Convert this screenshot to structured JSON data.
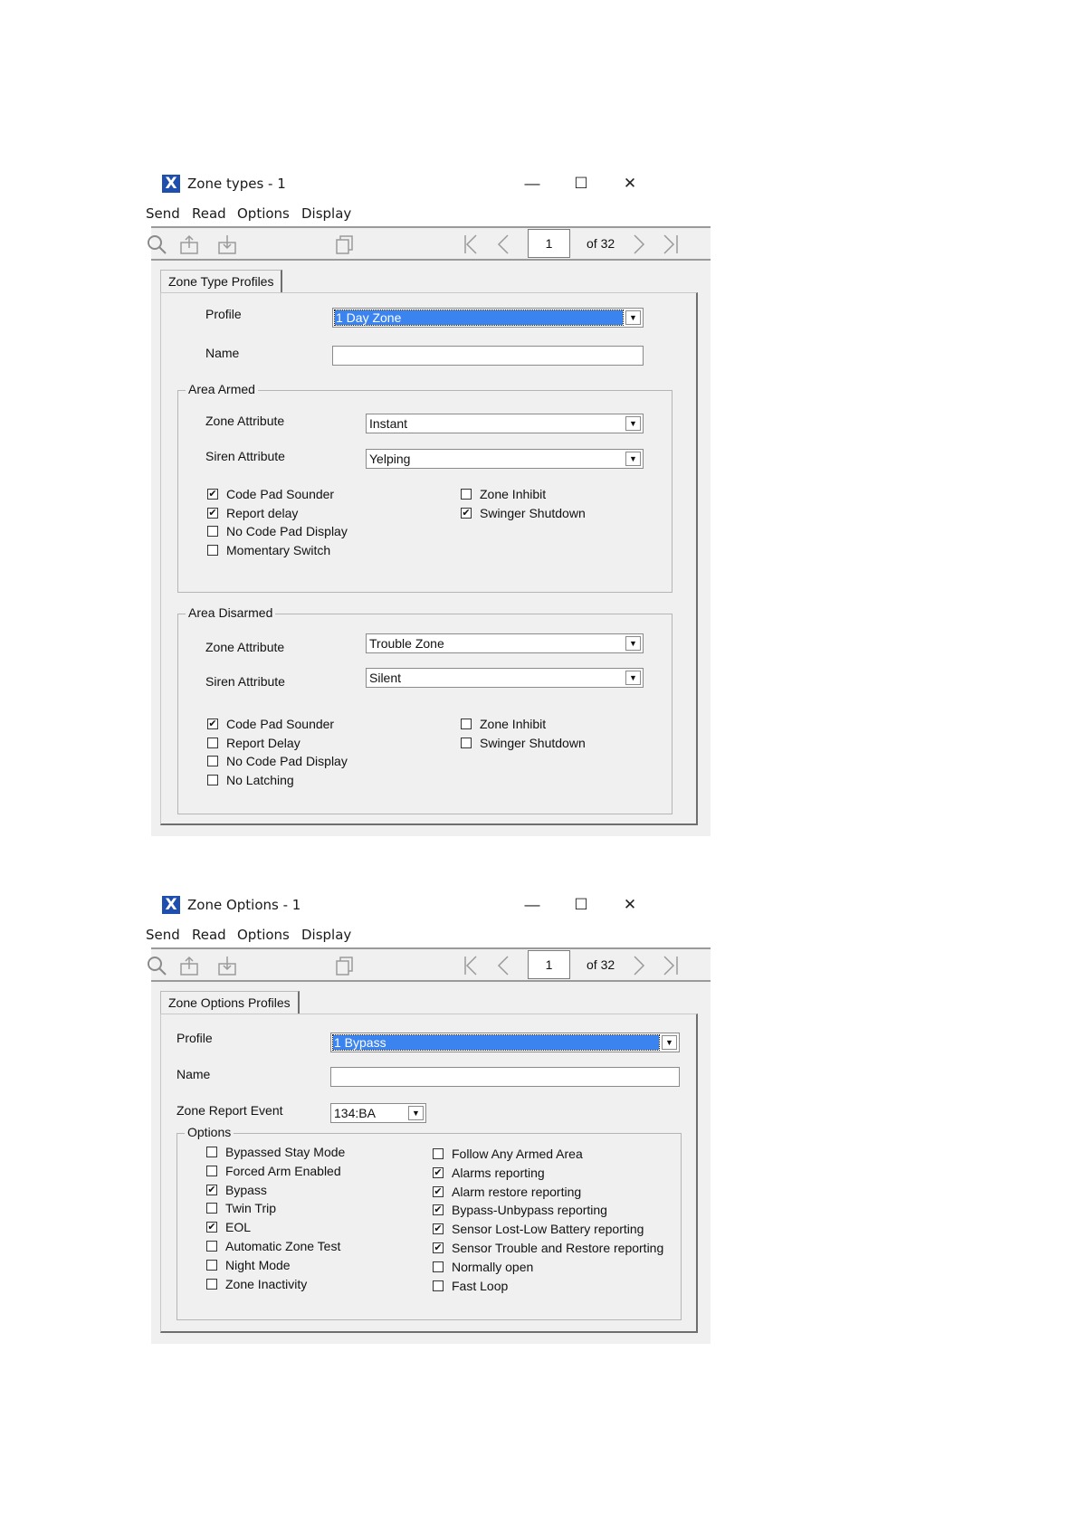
{
  "window1": {
    "title": "Zone types - 1",
    "menu": [
      "Send",
      "Read",
      "Options",
      "Display"
    ],
    "pager": {
      "page": "1",
      "of_label": "of 32"
    },
    "tab_label": "Zone Type Profiles",
    "profile_label": "Profile",
    "profile_value": "1 Day Zone",
    "name_label": "Name",
    "name_value": "",
    "area_armed": {
      "legend": "Area Armed",
      "zone_attribute_label": "Zone Attribute",
      "zone_attribute_value": "Instant",
      "siren_attribute_label": "Siren Attribute",
      "siren_attribute_value": "Yelping",
      "checks_left": [
        {
          "label": "Code Pad Sounder",
          "checked": true
        },
        {
          "label": "Report delay",
          "checked": true
        },
        {
          "label": "No Code Pad Display",
          "checked": false
        },
        {
          "label": "Momentary Switch",
          "checked": false
        }
      ],
      "checks_right": [
        {
          "label": "Zone Inhibit",
          "checked": false
        },
        {
          "label": "Swinger Shutdown",
          "checked": true
        }
      ]
    },
    "area_disarmed": {
      "legend": "Area Disarmed",
      "zone_attribute_label": "Zone Attribute",
      "zone_attribute_value": "Trouble Zone",
      "siren_attribute_label": "Siren Attribute",
      "siren_attribute_value": "Silent",
      "checks_left": [
        {
          "label": "Code Pad Sounder",
          "checked": true
        },
        {
          "label": "Report Delay",
          "checked": false
        },
        {
          "label": "No Code Pad Display",
          "checked": false
        },
        {
          "label": "No Latching",
          "checked": false
        }
      ],
      "checks_right": [
        {
          "label": "Zone Inhibit",
          "checked": false
        },
        {
          "label": "Swinger Shutdown",
          "checked": false
        }
      ]
    }
  },
  "window2": {
    "title": "Zone Options - 1",
    "menu": [
      "Send",
      "Read",
      "Options",
      "Display"
    ],
    "pager": {
      "page": "1",
      "of_label": "of 32"
    },
    "tab_label": "Zone Options Profiles",
    "profile_label": "Profile",
    "profile_value": "1 Bypass",
    "name_label": "Name",
    "name_value": "",
    "report_event_label": "Zone Report Event",
    "report_event_value": "134:BA",
    "options": {
      "legend": "Options",
      "checks_left": [
        {
          "label": "Bypassed Stay Mode",
          "checked": false
        },
        {
          "label": "Forced Arm Enabled",
          "checked": false
        },
        {
          "label": "Bypass",
          "checked": true
        },
        {
          "label": "Twin Trip",
          "checked": false
        },
        {
          "label": "EOL",
          "checked": true
        },
        {
          "label": "Automatic Zone Test",
          "checked": false
        },
        {
          "label": "Night Mode",
          "checked": false
        },
        {
          "label": "Zone Inactivity",
          "checked": false
        }
      ],
      "checks_right": [
        {
          "label": "Follow Any Armed Area",
          "checked": false
        },
        {
          "label": "Alarms reporting",
          "checked": true
        },
        {
          "label": "Alarm restore reporting",
          "checked": true
        },
        {
          "label": "Bypass-Unbypass reporting",
          "checked": true
        },
        {
          "label": "Sensor Lost-Low Battery reporting",
          "checked": true
        },
        {
          "label": "Sensor Trouble and Restore reporting",
          "checked": true
        },
        {
          "label": "Normally open",
          "checked": false
        },
        {
          "label": "Fast Loop",
          "checked": false
        }
      ]
    }
  },
  "icons": {
    "app": "app-x-icon",
    "minimize": "minimize-icon",
    "maximize": "maximize-icon",
    "close": "close-icon",
    "search": "search-icon",
    "upload": "upload-icon",
    "download": "download-icon",
    "copy": "copy-icon",
    "first": "first-page-icon",
    "prev": "previous-page-icon",
    "next": "next-page-icon",
    "last": "last-page-icon"
  },
  "colors": {
    "selection": "#3b84f0",
    "window_bg": "#f0f0f0",
    "app_icon": "#1f4fae"
  }
}
